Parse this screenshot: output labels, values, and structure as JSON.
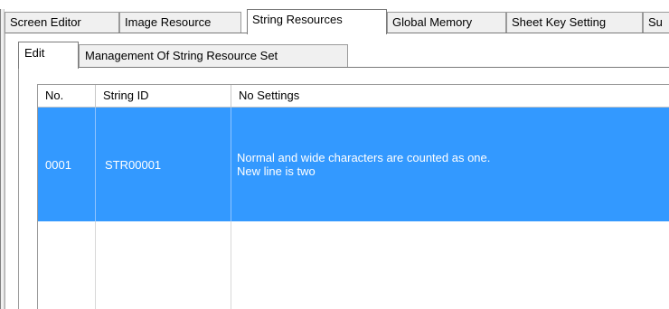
{
  "main_tabs": [
    {
      "label": "Screen Editor"
    },
    {
      "label": "Image Resource"
    },
    {
      "label": "String Resources"
    },
    {
      "label": "Global Memory"
    },
    {
      "label": "Sheet Key Setting"
    },
    {
      "label": "Su"
    }
  ],
  "active_main_tab": "String Resources",
  "sub_tabs": [
    {
      "label": "Edit"
    },
    {
      "label": "Management Of String Resource Set"
    }
  ],
  "active_sub_tab": "Edit",
  "table": {
    "headers": [
      "No.",
      "String ID",
      "No Settings"
    ],
    "rows": [
      {
        "no": "0001",
        "string_id": "STR00001",
        "text_line1": "Normal and wide characters are counted as one.",
        "text_line2": "New line is two",
        "selected": true
      }
    ]
  },
  "colors": {
    "selection": "#3399ff",
    "selection_text": "#ffffff"
  }
}
